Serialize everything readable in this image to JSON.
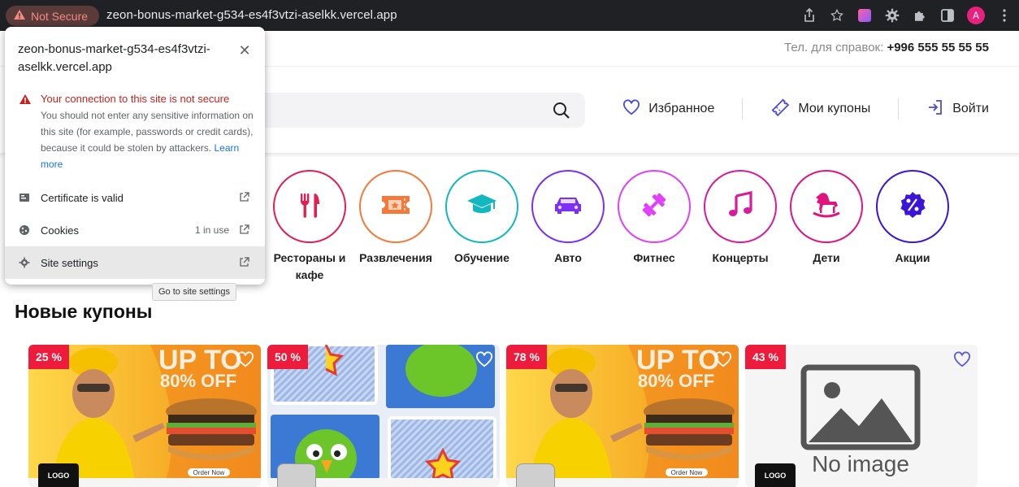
{
  "browser": {
    "security_label": "Not Secure",
    "url": "zeon-bonus-market-g534-es4f3vtzi-aselkk.vercel.app",
    "avatar_letter": "A"
  },
  "site_info": {
    "host": "zeon-bonus-market-g534-es4f3vtzi-aselkk.vercel.app",
    "warning_title": "Your connection to this site is not secure",
    "warning_text": "You should not enter any sensitive information on this site (for example, passwords or credit cards), because it could be stolen by attackers.",
    "learn_more": "Learn more",
    "rows": [
      {
        "label": "Certificate is valid",
        "meta": ""
      },
      {
        "label": "Cookies",
        "meta": "1 in use"
      },
      {
        "label": "Site settings",
        "meta": ""
      }
    ],
    "tooltip": "Go to site settings"
  },
  "header": {
    "contact_label": "Тел. для справок:",
    "contact_phone": "+996 555 55 55 55",
    "favorites": "Избранное",
    "my_coupons": "Мои купоны",
    "login": "Войти"
  },
  "categories": [
    {
      "label": "Рестораны и кафе",
      "color": "#e31e52",
      "icon": "fork-knife-icon"
    },
    {
      "label": "Развлечения",
      "color": "#f47a3c",
      "icon": "ticket-icon"
    },
    {
      "label": "Обучение",
      "color": "#13b7bf",
      "icon": "graduation-cap-icon"
    },
    {
      "label": "Авто",
      "color": "#7b2ff7",
      "icon": "car-icon"
    },
    {
      "label": "Фитнес",
      "color": "#e040fb",
      "icon": "dumbbell-icon"
    },
    {
      "label": "Концерты",
      "color": "#d81b9a",
      "icon": "music-note-icon"
    },
    {
      "label": "Дети",
      "color": "#e0147e",
      "icon": "rocking-horse-icon"
    },
    {
      "label": "Акции",
      "color": "#3a14d9",
      "icon": "percent-badge-icon"
    }
  ],
  "section_title": "Новые купоны",
  "coupons": [
    {
      "discount": "25 %",
      "image": "burger-promo",
      "promo_text": "UP TO 80% OFF",
      "order_label": "Order Now",
      "logo": "LOGO"
    },
    {
      "discount": "50 %",
      "image": "parrot-game",
      "promo_text": "",
      "order_label": "",
      "logo": ""
    },
    {
      "discount": "78 %",
      "image": "burger-promo",
      "promo_text": "UP TO 80% OFF",
      "order_label": "Order Now",
      "logo": ""
    },
    {
      "discount": "43 %",
      "image": "no-image",
      "promo_text": "No image",
      "order_label": "",
      "logo": "LOGO"
    }
  ],
  "colors": {
    "badge": "#ee1c3c",
    "accent": "#5b5bd6",
    "chrome_bg": "#202124"
  }
}
